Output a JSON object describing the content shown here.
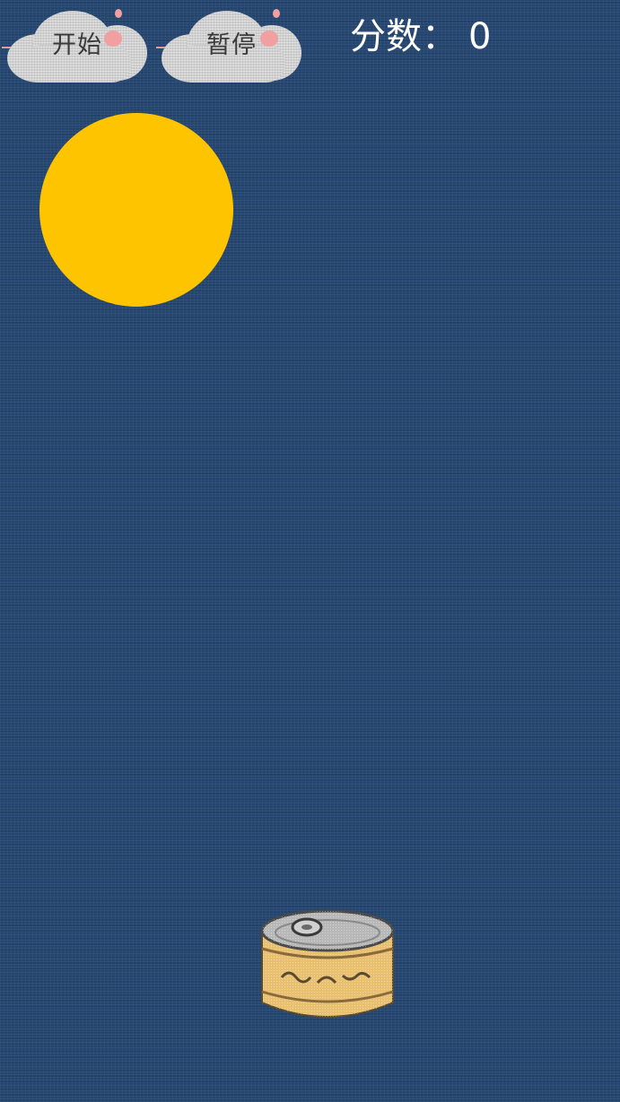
{
  "controls": {
    "start_label": "开始",
    "pause_label": "暂停"
  },
  "score": {
    "label": "分数：",
    "value": "0"
  },
  "colors": {
    "background": "#23456f",
    "ball": "#ffc400",
    "cloud": "#cfcfcf",
    "cloud_accent": "#f0a0a0",
    "can_body": "#e8c070",
    "can_lid": "#b8b8b8"
  },
  "icons": {
    "ball": "yellow-ball-icon",
    "basket": "tin-can-icon"
  }
}
